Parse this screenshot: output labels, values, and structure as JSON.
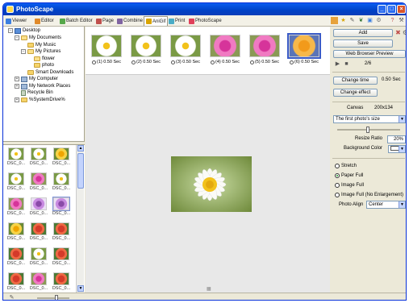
{
  "window": {
    "title": "PhotoScape"
  },
  "tabs": [
    {
      "label": "Viewer",
      "color": "#3c7fe0"
    },
    {
      "label": "Editor",
      "color": "#e08a2a"
    },
    {
      "label": "Batch Editor",
      "color": "#56a84a"
    },
    {
      "label": "Page",
      "color": "#c0504d"
    },
    {
      "label": "Combine",
      "color": "#8064a2"
    },
    {
      "label": "AniGif",
      "color": "#d9a400"
    },
    {
      "label": "Print",
      "color": "#4aacc6"
    },
    {
      "label": "PhotoScape",
      "color": "#e0405a"
    }
  ],
  "tree": [
    {
      "label": "Desktop",
      "expander": "−"
    },
    {
      "label": "My Documents",
      "expander": "−"
    },
    {
      "label": "My Music",
      "expander": ""
    },
    {
      "label": "My Pictures",
      "expander": "−"
    },
    {
      "label": "flower",
      "expander": ""
    },
    {
      "label": "photo",
      "expander": ""
    },
    {
      "label": "Smart Downloads",
      "expander": ""
    },
    {
      "label": "My Computer",
      "expander": "+"
    },
    {
      "label": "My Network Places",
      "expander": "+"
    },
    {
      "label": "Recycle Bin",
      "expander": ""
    },
    {
      "label": "%SystemDrive%",
      "expander": "+"
    }
  ],
  "thumbnails": [
    {
      "label": "DSC_0...",
      "palette": "white-daisy"
    },
    {
      "label": "DSC_0...",
      "palette": "white-daisy"
    },
    {
      "label": "DSC_0...",
      "palette": "yellow"
    },
    {
      "label": "DSC_0...",
      "palette": "white-daisy"
    },
    {
      "label": "DSC_0...",
      "palette": "pink"
    },
    {
      "label": "DSC_0...",
      "palette": "white-daisy"
    },
    {
      "label": "DSC_0...",
      "palette": "pink"
    },
    {
      "label": "DSC_0...",
      "palette": "purple"
    },
    {
      "label": "DSC_0...",
      "palette": "purple"
    },
    {
      "label": "DSC_0...",
      "palette": "yellow"
    },
    {
      "label": "DSC_0...",
      "palette": "red"
    },
    {
      "label": "DSC_0...",
      "palette": "red"
    },
    {
      "label": "DSC_0...",
      "palette": "red"
    },
    {
      "label": "DSC_0...",
      "palette": "white-daisy"
    },
    {
      "label": "DSC_0...",
      "palette": "red"
    },
    {
      "label": "DSC_0...",
      "palette": "red"
    },
    {
      "label": "DSC_0...",
      "palette": "pink"
    },
    {
      "label": "DSC_0...",
      "palette": "red"
    }
  ],
  "frames": [
    {
      "caption": "(1) 0.50 Sec",
      "palette": "white-daisy"
    },
    {
      "caption": "(2) 0.50 Sec",
      "palette": "white-daisy"
    },
    {
      "caption": "(3) 0.50 Sec",
      "palette": "white-daisy"
    },
    {
      "caption": "(4) 0.50 Sec",
      "palette": "pink"
    },
    {
      "caption": "(5) 0.50 Sec",
      "palette": "pink"
    },
    {
      "caption": "(6) 0.50 Sec",
      "palette": "orange"
    }
  ],
  "right": {
    "add": "Add",
    "save": "Save",
    "browser_preview": "Web Browser Preview",
    "counter": "2/6",
    "change_time": "Change time",
    "time_value": "0.50 Sec",
    "change_effect": "Change effect",
    "canvas_label": "Canvas",
    "canvas_value": "200x134",
    "size_select": "The first photo's size",
    "resize_ratio_label": "Resize Ratio",
    "resize_ratio_value": "20%",
    "background_color_label": "Background Color",
    "background_color_value": "#ffffff",
    "radios": [
      {
        "label": "Stretch",
        "checked": false
      },
      {
        "label": "Paper Full",
        "checked": true
      },
      {
        "label": "Image Full",
        "checked": false
      },
      {
        "label": "Image Full (No Enlargement)",
        "checked": false
      }
    ],
    "photo_align_label": "Photo Align",
    "photo_align_value": "Center"
  }
}
